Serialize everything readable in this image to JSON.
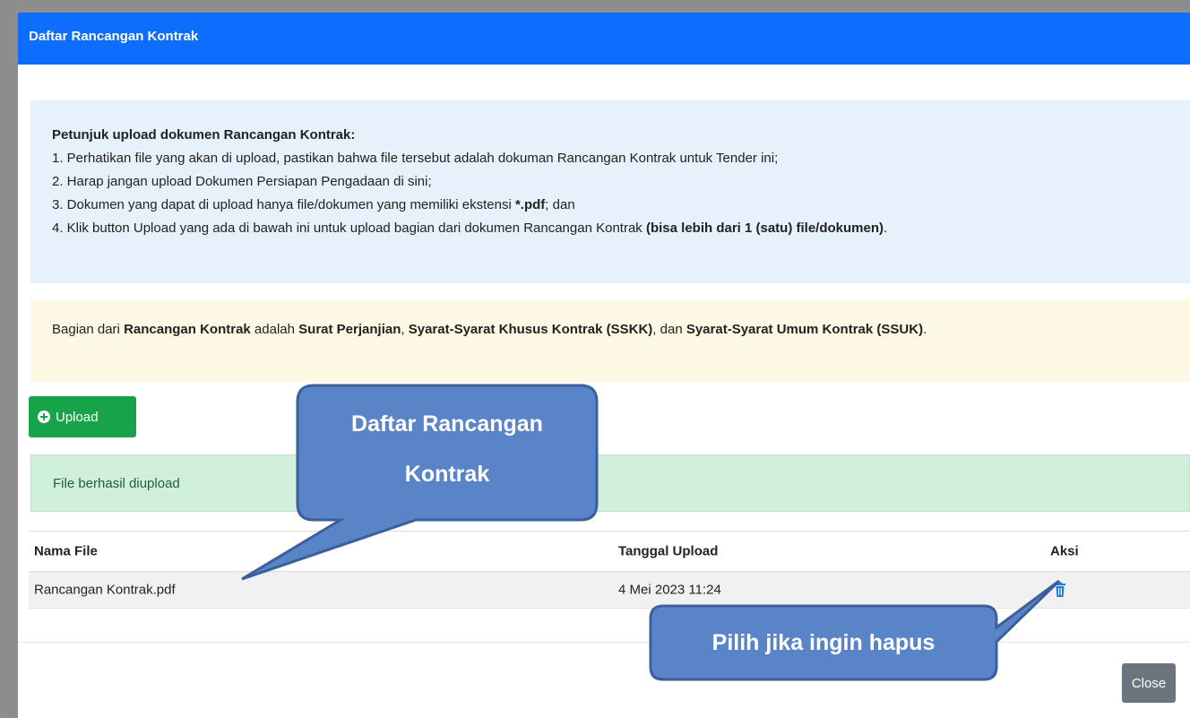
{
  "modal": {
    "title": "Daftar Rancangan Kontrak"
  },
  "instructions": {
    "heading": "Petunjuk upload dokumen Rancangan Kontrak:",
    "line1": "1. Perhatikan file yang akan di upload, pastikan bahwa file tersebut adalah dokuman Rancangan Kontrak untuk Tender ini;",
    "line2": "2. Harap jangan upload Dokumen Persiapan Pengadaan di sini;",
    "line3_pre": "3. Dokumen yang dapat di upload hanya file/dokumen yang memiliki ekstensi ",
    "line3_ext": "*.pdf",
    "line3_post": "; dan",
    "line4_pre": "4. Klik button Upload yang ada di bawah ini untuk upload bagian dari dokumen Rancangan Kontrak ",
    "line4_bold": "(bisa lebih dari 1 (satu) file/dokumen)",
    "line4_post": "."
  },
  "warning": {
    "t1": "Bagian dari ",
    "b1": "Rancangan Kontrak",
    "t2": " adalah ",
    "b2": "Surat Perjanjian",
    "t3": ", ",
    "b3": "Syarat-Syarat Khusus Kontrak (SSKK)",
    "t4": ", dan ",
    "b4": "Syarat-Syarat Umum Kontrak (SSUK)",
    "t5": "."
  },
  "upload_button": {
    "label": "Upload",
    "icon": "plus-circle-icon"
  },
  "success_alert": {
    "text": "File berhasil diupload"
  },
  "table": {
    "headers": [
      "Nama File",
      "Tanggal Upload",
      "Aksi"
    ],
    "rows": [
      {
        "name": "Rancangan Kontrak.pdf",
        "date": "4 Mei 2023 11:24",
        "action_icon": "trash-icon"
      }
    ]
  },
  "close_button": {
    "label": "Close"
  },
  "callouts": [
    {
      "line1": "Daftar Rancangan",
      "line2": "Kontrak"
    },
    {
      "text": "Pilih jika ingin hapus"
    }
  ],
  "colors": {
    "header_blue": "#0d6efd",
    "upload_green": "#16a34a",
    "success_bg": "#d1f0dc",
    "info_bg": "#e7f1fb",
    "warning_bg": "#fdf8e4",
    "close_gray": "#6c757d",
    "callout_fill": "#5a84c8",
    "callout_border": "#3b5f9a"
  }
}
